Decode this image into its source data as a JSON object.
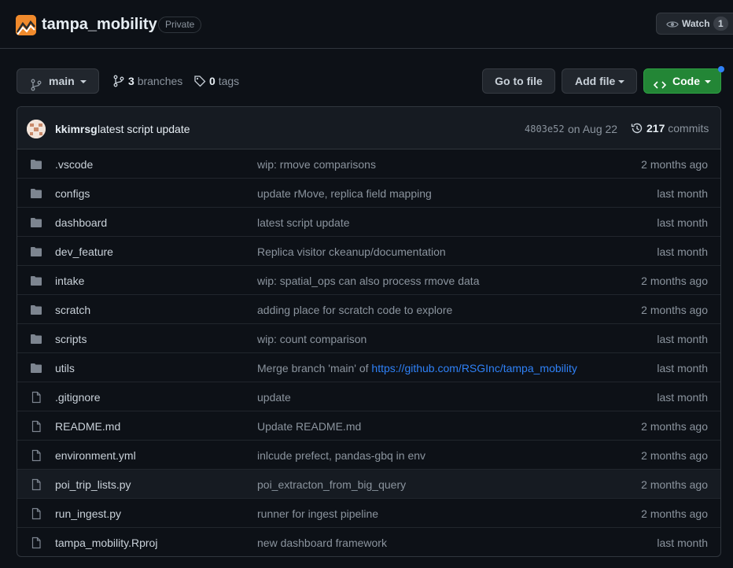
{
  "repo": {
    "name": "tampa_mobility",
    "visibility": "Private",
    "icon": "repo-logo-icon"
  },
  "watch": {
    "label": "Watch",
    "count": "1",
    "icon": "eye-icon"
  },
  "branch": {
    "current": "main",
    "icon": "git-branch-icon"
  },
  "branches": {
    "count": "3",
    "label": "branches",
    "icon": "git-branch-icon"
  },
  "tags": {
    "count": "0",
    "label": "tags",
    "icon": "tag-icon"
  },
  "buttons": {
    "go_to_file": "Go to file",
    "add_file": "Add file",
    "code": "Code"
  },
  "colors": {
    "background": "#0d1117",
    "code_button": "#238636",
    "link": "#2f81f7",
    "notification_dot": "#2f81f7"
  },
  "latest_commit": {
    "author": "kkimrsg",
    "message": "latest script update",
    "hash": "4803e52",
    "date": "on Aug 22",
    "commits_count": "217",
    "commits_label": "commits"
  },
  "files": [
    {
      "type": "folder",
      "name": ".vscode",
      "message": "wip: rmove comparisons",
      "age": "2 months ago"
    },
    {
      "type": "folder",
      "name": "configs",
      "message": "update rMove, replica field mapping",
      "age": "last month"
    },
    {
      "type": "folder",
      "name": "dashboard",
      "message": "latest script update",
      "age": "last month"
    },
    {
      "type": "folder",
      "name": "dev_feature",
      "message": "Replica visitor ckeanup/documentation",
      "age": "last month"
    },
    {
      "type": "folder",
      "name": "intake",
      "message": "wip: spatial_ops can also process rmove data",
      "age": "2 months ago"
    },
    {
      "type": "folder",
      "name": "scratch",
      "message": "adding place for scratch code to explore",
      "age": "2 months ago"
    },
    {
      "type": "folder",
      "name": "scripts",
      "message": "wip: count comparison",
      "age": "last month"
    },
    {
      "type": "folder",
      "name": "utils",
      "message": "Merge branch 'main' of ",
      "link": "https://github.com/RSGInc/tampa_mobility",
      "age": "last month"
    },
    {
      "type": "file",
      "name": ".gitignore",
      "message": "update",
      "age": "last month"
    },
    {
      "type": "file",
      "name": "README.md",
      "message": "Update README.md",
      "age": "2 months ago"
    },
    {
      "type": "file",
      "name": "environment.yml",
      "message": "inlcude prefect, pandas-gbq in env",
      "age": "2 months ago"
    },
    {
      "type": "file",
      "name": "poi_trip_lists.py",
      "message": "poi_extracton_from_big_query",
      "age": "2 months ago"
    },
    {
      "type": "file",
      "name": "run_ingest.py",
      "message": "runner for ingest pipeline",
      "age": "2 months ago"
    },
    {
      "type": "file",
      "name": "tampa_mobility.Rproj",
      "message": "new dashboard framework",
      "age": "last month"
    }
  ]
}
